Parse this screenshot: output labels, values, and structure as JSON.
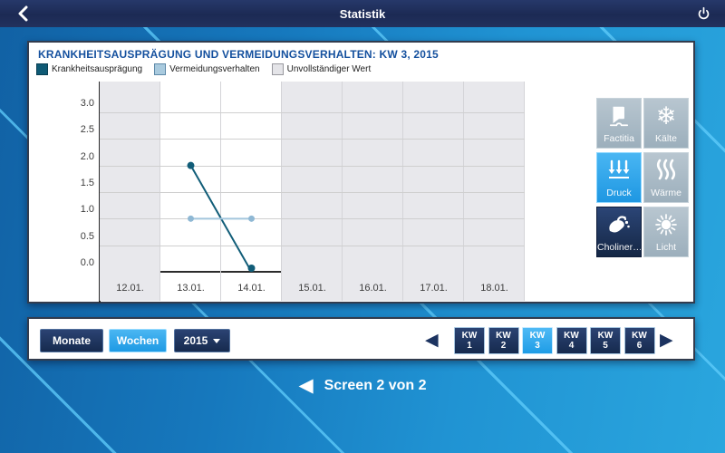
{
  "topbar": {
    "title": "Statistik"
  },
  "chart": {
    "title": "KRANKHEITSAUSPRÄGUNG UND VERMEIDUNGSVERHALTEN: KW 3, 2015",
    "legend": [
      {
        "label": "Krankheitsausprägung",
        "color": "#0f5a75",
        "border": "#0a3f53"
      },
      {
        "label": "Vermeidungsverhalten",
        "color": "#a9cade",
        "border": "#5d89a9"
      },
      {
        "label": "Unvollständiger Wert",
        "color": "#e4e4e8",
        "border": "#98989e"
      }
    ],
    "chart_data": {
      "type": "line",
      "categories": [
        "12.01.",
        "13.01.",
        "14.01.",
        "15.01.",
        "16.01.",
        "17.01.",
        "18.01."
      ],
      "yticks": [
        0.0,
        0.5,
        1.0,
        1.5,
        2.0,
        2.5,
        3.0
      ],
      "ylim": [
        0,
        3.6
      ],
      "grid": true,
      "legend_position": "top",
      "series": [
        {
          "name": "Krankheitsausprägung",
          "color": "#115d78",
          "dot_radius": 4,
          "points": [
            {
              "category": "13.01.",
              "value": 2.0
            },
            {
              "category": "14.01.",
              "value": 0.0
            }
          ]
        },
        {
          "name": "Vermeidungsverhalten",
          "color": "#a3c6dd",
          "dot_color": "#8fb8d4",
          "dot_radius": 3.5,
          "points": [
            {
              "category": "13.01.",
              "value": 1.0
            },
            {
              "category": "14.01.",
              "value": 1.0
            }
          ]
        }
      ],
      "incomplete_columns": [
        "12.01.",
        "15.01.",
        "16.01.",
        "17.01.",
        "18.01."
      ]
    }
  },
  "triggers": [
    {
      "label": "Factitia",
      "icon": "factitia-icon",
      "state": "inactive"
    },
    {
      "label": "Kälte",
      "icon": "snowflake-icon",
      "state": "inactive"
    },
    {
      "label": "Druck",
      "icon": "pressure-icon",
      "state": "active"
    },
    {
      "label": "Wärme",
      "icon": "heat-icon",
      "state": "inactive"
    },
    {
      "label": "Choliner…",
      "icon": "cholinergic-icon",
      "state": "dark"
    },
    {
      "label": "Licht",
      "icon": "sun-icon",
      "state": "inactive"
    }
  ],
  "controls": {
    "monate_label": "Monate",
    "wochen_label": "Wochen",
    "year_value": "2015",
    "weeks": [
      {
        "line1": "KW",
        "line2": "1",
        "selected": false
      },
      {
        "line1": "KW",
        "line2": "2",
        "selected": false
      },
      {
        "line1": "KW",
        "line2": "3",
        "selected": true
      },
      {
        "line1": "KW",
        "line2": "4",
        "selected": false
      },
      {
        "line1": "KW",
        "line2": "5",
        "selected": false
      },
      {
        "line1": "KW",
        "line2": "6",
        "selected": false
      }
    ],
    "prev_arrow": "◀",
    "next_arrow": "▶"
  },
  "pager": {
    "arrow": "◀",
    "text": "Screen 2 von 2"
  }
}
